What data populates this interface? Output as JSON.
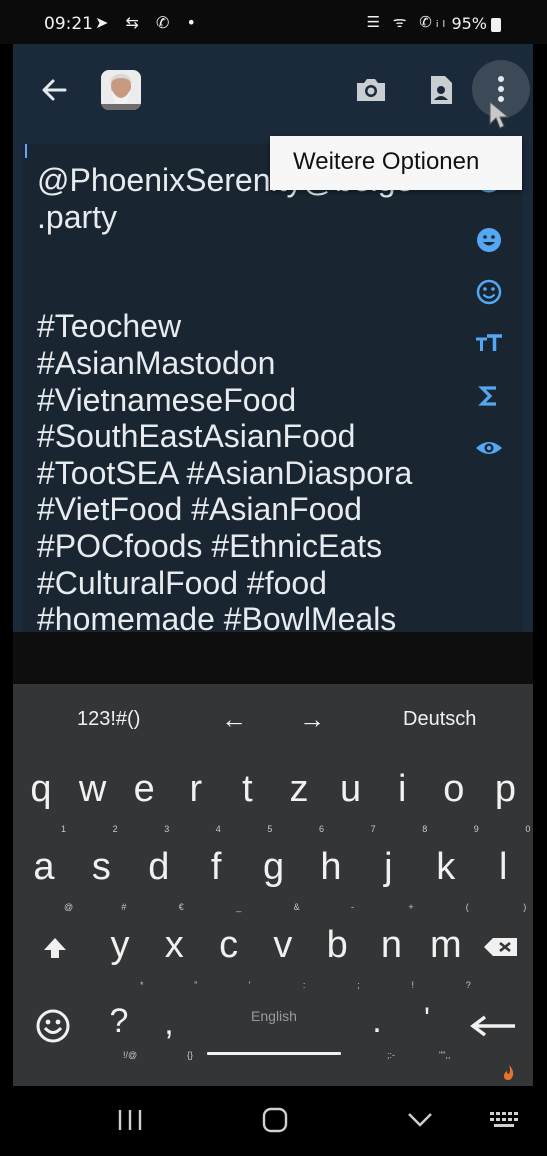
{
  "status_bar": {
    "time": "09:21",
    "left_icons": "➤ ⇆ ✆ •",
    "right_icons": "☰ ᯤ ✆ᵢₗ",
    "battery": "95%"
  },
  "appbar": {
    "icons": [
      "back-arrow-icon",
      "avatar",
      "camera-icon",
      "contact-card-icon",
      "more-vert-icon"
    ]
  },
  "tooltip": {
    "text": "Weitere Optionen"
  },
  "editor": {
    "text": "@PhoenixSerenity@beige\n.party\n\n\n#Teochew\n#AsianMastodon\n#VietnameseFood\n#SouthEastAsianFood\n#TootSEA #AsianDiaspora\n#VietFood #AsianFood\n#POCfoods #EthnicEats\n#CulturalFood #food\n#homemade #BowlMeals"
  },
  "side_tools": [
    "add-circle-icon",
    "emoji-filled-icon",
    "emoji-outline-icon",
    "text-size-icon",
    "sigma-icon",
    "eye-icon"
  ],
  "keyboard": {
    "toolbar": {
      "symbols": "123!#()",
      "left_arrow": "←",
      "right_arrow": "→",
      "language": "Deutsch"
    },
    "row1": [
      {
        "k": "q",
        "s": "1"
      },
      {
        "k": "w",
        "s": "2"
      },
      {
        "k": "e",
        "s": "3"
      },
      {
        "k": "r",
        "s": "4"
      },
      {
        "k": "t",
        "s": "5"
      },
      {
        "k": "z",
        "s": "6"
      },
      {
        "k": "u",
        "s": "7"
      },
      {
        "k": "i",
        "s": "8"
      },
      {
        "k": "o",
        "s": "9"
      },
      {
        "k": "p",
        "s": "0"
      }
    ],
    "row2": [
      {
        "k": "a",
        "s": "@"
      },
      {
        "k": "s",
        "s": "#"
      },
      {
        "k": "d",
        "s": "€"
      },
      {
        "k": "f",
        "s": "_"
      },
      {
        "k": "g",
        "s": "&"
      },
      {
        "k": "h",
        "s": "-"
      },
      {
        "k": "j",
        "s": "+"
      },
      {
        "k": "k",
        "s": "("
      },
      {
        "k": "l",
        "s": ")"
      }
    ],
    "row3": [
      {
        "k": "y",
        "s": "*"
      },
      {
        "k": "x",
        "s": "\""
      },
      {
        "k": "c",
        "s": "'"
      },
      {
        "k": "v",
        "s": ":"
      },
      {
        "k": "b",
        "s": ";"
      },
      {
        "k": "n",
        "s": "!"
      },
      {
        "k": "m",
        "s": "?"
      }
    ],
    "row4": {
      "question": "?",
      "question_sub": "!/@",
      "comma": ",",
      "comma_sub": "{}",
      "space_label": "English",
      "period": ".",
      "period_sub": ";:-",
      "apostrophe": "'",
      "apostrophe_sub": "\"\",,"
    }
  }
}
